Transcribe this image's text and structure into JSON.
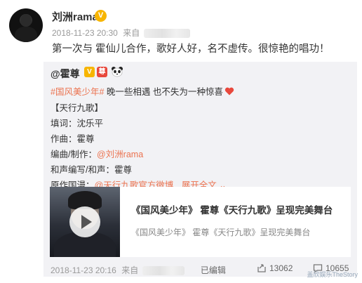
{
  "post": {
    "username": "刘洲rama",
    "badge": "V",
    "timestamp": "2018-11-23 20:30",
    "source_prefix": "来自",
    "text": "第一次与 霍仙儿合作，歌好人好，名不虚传。很惊艳的唱功！"
  },
  "repost": {
    "author": "@霍尊",
    "badges": [
      "V",
      "尊"
    ],
    "hashtag": "#国风美少年#",
    "hashtag_text": " 晚一些相遇 也不失为一种惊喜",
    "song_title": "【天行九歌】",
    "lyricist_label": "填词：",
    "lyricist": "沈乐平",
    "composer_label": "作曲：",
    "composer": "霍尊",
    "arranger_label": "编曲/制作：",
    "arranger": "@刘洲rama",
    "harmony_label": "和声编写/和声：",
    "harmony": "霍尊",
    "anime_label": "原作国漫：",
    "anime": "@天行九歌官方微博",
    "expand": "展开全文",
    "card_title": "《国风美少年》 霍尊《天行九歌》呈现完美舞台",
    "card_subtitle": "《国风美少年》 霍尊《天行九歌》呈现完美舞台",
    "timestamp": "2018-11-23 20:16",
    "source_prefix": "来自",
    "edited": "已编辑",
    "reposts": "13062",
    "comments": "10655"
  },
  "watermark": "盖欣娱乐TheStory",
  "colors": {
    "link": "#eb7350",
    "badge_gold": "#f7b500",
    "repost_bg": "#f2f2f5"
  }
}
